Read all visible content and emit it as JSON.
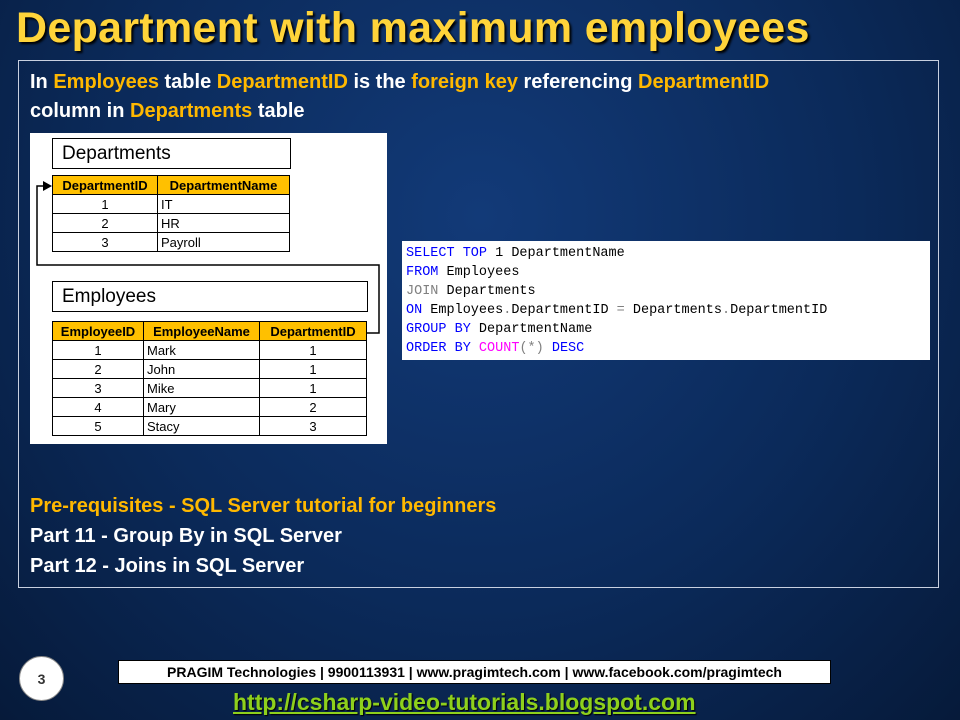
{
  "title": "Department with maximum employees",
  "intro": {
    "p1": "In ",
    "h1": "Employees",
    "p2": " table ",
    "h2": "DepartmentID",
    "p3": " is the ",
    "h3": "foreign key",
    "p4": " referencing ",
    "h4": "DepartmentID",
    "p5": "column in ",
    "h5": "Departments",
    "p6": " table"
  },
  "departments": {
    "title": "Departments",
    "headers": [
      "DepartmentID",
      "DepartmentName"
    ],
    "rows": [
      [
        "1",
        "IT"
      ],
      [
        "2",
        "HR"
      ],
      [
        "3",
        "Payroll"
      ]
    ]
  },
  "employees": {
    "title": "Employees",
    "headers": [
      "EmployeeID",
      "EmployeeName",
      "DepartmentID"
    ],
    "rows": [
      [
        "1",
        "Mark",
        "1"
      ],
      [
        "2",
        "John",
        "1"
      ],
      [
        "3",
        "Mike",
        "1"
      ],
      [
        "4",
        "Mary",
        "2"
      ],
      [
        "5",
        "Stacy",
        "3"
      ]
    ]
  },
  "sql": {
    "l1a": "SELECT TOP",
    "l1b": " 1 DepartmentName",
    "l2a": "FROM",
    "l2b": " Employees",
    "l3a": "JOIN",
    "l3b": " Departments",
    "l4a": "ON",
    "l4b": " Employees",
    "l4c": ".",
    "l4d": "DepartmentID ",
    "l4e": "=",
    "l4f": " Departments",
    "l4g": ".",
    "l4h": "DepartmentID",
    "l5a": "GROUP BY",
    "l5b": " DepartmentName",
    "l6a": "ORDER BY",
    "l6b": " ",
    "l6c": "COUNT",
    "l6d": "(*)",
    "l6e": " DESC"
  },
  "links": {
    "prereq": "Pre-requisites - SQL Server tutorial for beginners",
    "part11": "Part 11 - Group By in SQL Server",
    "part12": "Part 12 - Joins in SQL Server"
  },
  "page_number": "3",
  "footer": "PRAGIM Technologies | 9900113931 | www.pragimtech.com | www.facebook.com/pragimtech",
  "blog_url": "http://csharp-video-tutorials.blogspot.com"
}
